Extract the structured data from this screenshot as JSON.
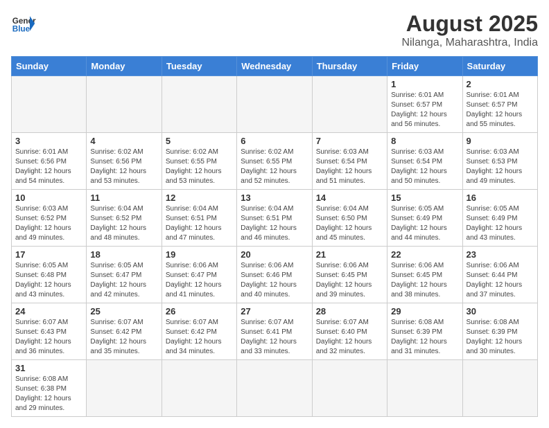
{
  "header": {
    "logo_general": "General",
    "logo_blue": "Blue",
    "title": "August 2025",
    "subtitle": "Nilanga, Maharashtra, India"
  },
  "weekdays": [
    "Sunday",
    "Monday",
    "Tuesday",
    "Wednesday",
    "Thursday",
    "Friday",
    "Saturday"
  ],
  "weeks": [
    [
      {
        "day": "",
        "info": ""
      },
      {
        "day": "",
        "info": ""
      },
      {
        "day": "",
        "info": ""
      },
      {
        "day": "",
        "info": ""
      },
      {
        "day": "",
        "info": ""
      },
      {
        "day": "1",
        "info": "Sunrise: 6:01 AM\nSunset: 6:57 PM\nDaylight: 12 hours and 56 minutes."
      },
      {
        "day": "2",
        "info": "Sunrise: 6:01 AM\nSunset: 6:57 PM\nDaylight: 12 hours and 55 minutes."
      }
    ],
    [
      {
        "day": "3",
        "info": "Sunrise: 6:01 AM\nSunset: 6:56 PM\nDaylight: 12 hours and 54 minutes."
      },
      {
        "day": "4",
        "info": "Sunrise: 6:02 AM\nSunset: 6:56 PM\nDaylight: 12 hours and 53 minutes."
      },
      {
        "day": "5",
        "info": "Sunrise: 6:02 AM\nSunset: 6:55 PM\nDaylight: 12 hours and 53 minutes."
      },
      {
        "day": "6",
        "info": "Sunrise: 6:02 AM\nSunset: 6:55 PM\nDaylight: 12 hours and 52 minutes."
      },
      {
        "day": "7",
        "info": "Sunrise: 6:03 AM\nSunset: 6:54 PM\nDaylight: 12 hours and 51 minutes."
      },
      {
        "day": "8",
        "info": "Sunrise: 6:03 AM\nSunset: 6:54 PM\nDaylight: 12 hours and 50 minutes."
      },
      {
        "day": "9",
        "info": "Sunrise: 6:03 AM\nSunset: 6:53 PM\nDaylight: 12 hours and 49 minutes."
      }
    ],
    [
      {
        "day": "10",
        "info": "Sunrise: 6:03 AM\nSunset: 6:52 PM\nDaylight: 12 hours and 49 minutes."
      },
      {
        "day": "11",
        "info": "Sunrise: 6:04 AM\nSunset: 6:52 PM\nDaylight: 12 hours and 48 minutes."
      },
      {
        "day": "12",
        "info": "Sunrise: 6:04 AM\nSunset: 6:51 PM\nDaylight: 12 hours and 47 minutes."
      },
      {
        "day": "13",
        "info": "Sunrise: 6:04 AM\nSunset: 6:51 PM\nDaylight: 12 hours and 46 minutes."
      },
      {
        "day": "14",
        "info": "Sunrise: 6:04 AM\nSunset: 6:50 PM\nDaylight: 12 hours and 45 minutes."
      },
      {
        "day": "15",
        "info": "Sunrise: 6:05 AM\nSunset: 6:49 PM\nDaylight: 12 hours and 44 minutes."
      },
      {
        "day": "16",
        "info": "Sunrise: 6:05 AM\nSunset: 6:49 PM\nDaylight: 12 hours and 43 minutes."
      }
    ],
    [
      {
        "day": "17",
        "info": "Sunrise: 6:05 AM\nSunset: 6:48 PM\nDaylight: 12 hours and 43 minutes."
      },
      {
        "day": "18",
        "info": "Sunrise: 6:05 AM\nSunset: 6:47 PM\nDaylight: 12 hours and 42 minutes."
      },
      {
        "day": "19",
        "info": "Sunrise: 6:06 AM\nSunset: 6:47 PM\nDaylight: 12 hours and 41 minutes."
      },
      {
        "day": "20",
        "info": "Sunrise: 6:06 AM\nSunset: 6:46 PM\nDaylight: 12 hours and 40 minutes."
      },
      {
        "day": "21",
        "info": "Sunrise: 6:06 AM\nSunset: 6:45 PM\nDaylight: 12 hours and 39 minutes."
      },
      {
        "day": "22",
        "info": "Sunrise: 6:06 AM\nSunset: 6:45 PM\nDaylight: 12 hours and 38 minutes."
      },
      {
        "day": "23",
        "info": "Sunrise: 6:06 AM\nSunset: 6:44 PM\nDaylight: 12 hours and 37 minutes."
      }
    ],
    [
      {
        "day": "24",
        "info": "Sunrise: 6:07 AM\nSunset: 6:43 PM\nDaylight: 12 hours and 36 minutes."
      },
      {
        "day": "25",
        "info": "Sunrise: 6:07 AM\nSunset: 6:42 PM\nDaylight: 12 hours and 35 minutes."
      },
      {
        "day": "26",
        "info": "Sunrise: 6:07 AM\nSunset: 6:42 PM\nDaylight: 12 hours and 34 minutes."
      },
      {
        "day": "27",
        "info": "Sunrise: 6:07 AM\nSunset: 6:41 PM\nDaylight: 12 hours and 33 minutes."
      },
      {
        "day": "28",
        "info": "Sunrise: 6:07 AM\nSunset: 6:40 PM\nDaylight: 12 hours and 32 minutes."
      },
      {
        "day": "29",
        "info": "Sunrise: 6:08 AM\nSunset: 6:39 PM\nDaylight: 12 hours and 31 minutes."
      },
      {
        "day": "30",
        "info": "Sunrise: 6:08 AM\nSunset: 6:39 PM\nDaylight: 12 hours and 30 minutes."
      }
    ],
    [
      {
        "day": "31",
        "info": "Sunrise: 6:08 AM\nSunset: 6:38 PM\nDaylight: 12 hours and 29 minutes."
      },
      {
        "day": "",
        "info": ""
      },
      {
        "day": "",
        "info": ""
      },
      {
        "day": "",
        "info": ""
      },
      {
        "day": "",
        "info": ""
      },
      {
        "day": "",
        "info": ""
      },
      {
        "day": "",
        "info": ""
      }
    ]
  ]
}
